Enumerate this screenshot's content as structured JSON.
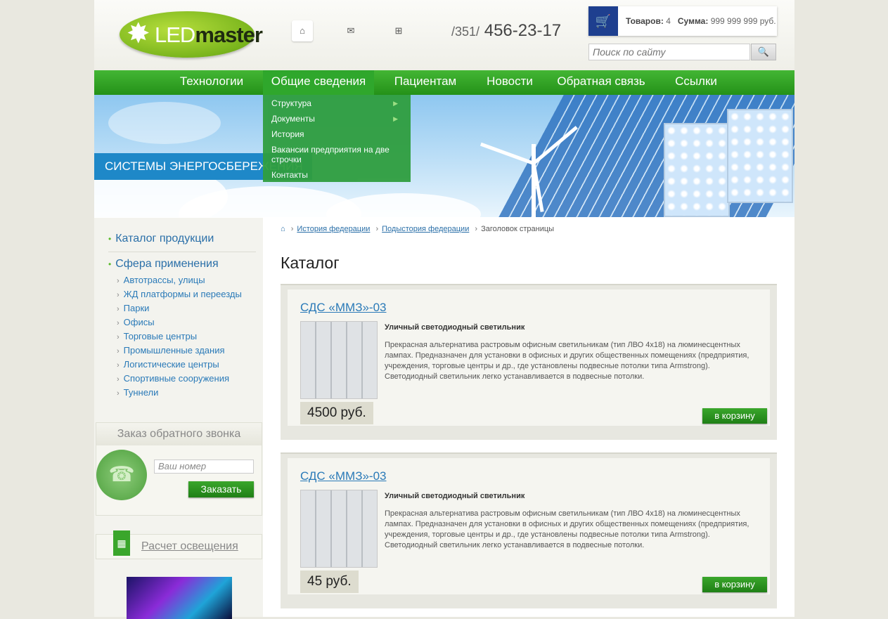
{
  "header": {
    "logo_text_light": "LED",
    "logo_text_dark": "master",
    "phone_code": "/351/",
    "phone_number": "456-23-17",
    "cart": {
      "items_label": "Товаров:",
      "items_count": "4",
      "sum_label": "Сумма:",
      "sum_value": "999 999 999 руб."
    },
    "search_placeholder": "Поиск по сайту"
  },
  "nav": {
    "items": [
      "Технологии",
      "Общие сведения",
      "Пациентам",
      "Новости",
      "Обратная связь",
      "Ссылки"
    ],
    "active_index": 1,
    "dropdown": [
      "Структура",
      "Документы",
      "История",
      "Вакансии предприятия на две строчки",
      "Контакты"
    ]
  },
  "banner": {
    "title": "СИСТЕМЫ ЭНЕРГОСБЕРЕЖЕНИЯ"
  },
  "sidebar": {
    "catalog": "Каталог продукции",
    "sphere": "Сфера применения",
    "sub_items": [
      "Автотрассы, улицы",
      "ЖД платформы и переезды",
      "Парки",
      "Офисы",
      "Торговые центры",
      "Промышленные здания",
      "Логистические центры",
      "Спортивные сооружения",
      "Туннели"
    ],
    "callback": {
      "title": "Заказ обратного звонка",
      "placeholder": "Ваш номер",
      "button": "Заказать"
    },
    "calc": "Расчет освещения"
  },
  "breadcrumbs": [
    "История федерации",
    "Подыстория федерации",
    "Заголовок страницы"
  ],
  "page_title": "Каталог",
  "products": [
    {
      "title": "СДС «ММЗ»-03",
      "subtitle": "Уличный светодиодный светильник",
      "description": "Прекрасная альтернатива растровым офисным светильникам (тип ЛВО 4х18) на люминесцентных лампах. Предназначен для установки в офисных и других общественных помещениях (предприятия, учреждения, торговые центры и др., где установлены подвесные потолки типа Armstrong). Светодиодный светильник легко устанавливается в подвесные потолки.",
      "price": "4500 руб.",
      "button": "в корзину"
    },
    {
      "title": "СДС «ММЗ»-03",
      "subtitle": "Уличный светодиодный светильник",
      "description": "Прекрасная альтернатива растровым офисным светильникам (тип ЛВО 4х18) на люминесцентных лампах. Предназначен для установки в офисных и других общественных помещениях (предприятия, учреждения, торговые центры и др., где установлены подвесные потолки типа Armstrong). Светодиодный светильник легко устанавливается в подвесные потолки.",
      "price": "45 руб.",
      "button": "в корзину"
    }
  ],
  "colors": {
    "nav_green": "#2d9e22",
    "link_blue": "#2a7ab8",
    "banner_title_bg": "#1e88c8",
    "cart_icon_bg": "#1e3f8f"
  }
}
